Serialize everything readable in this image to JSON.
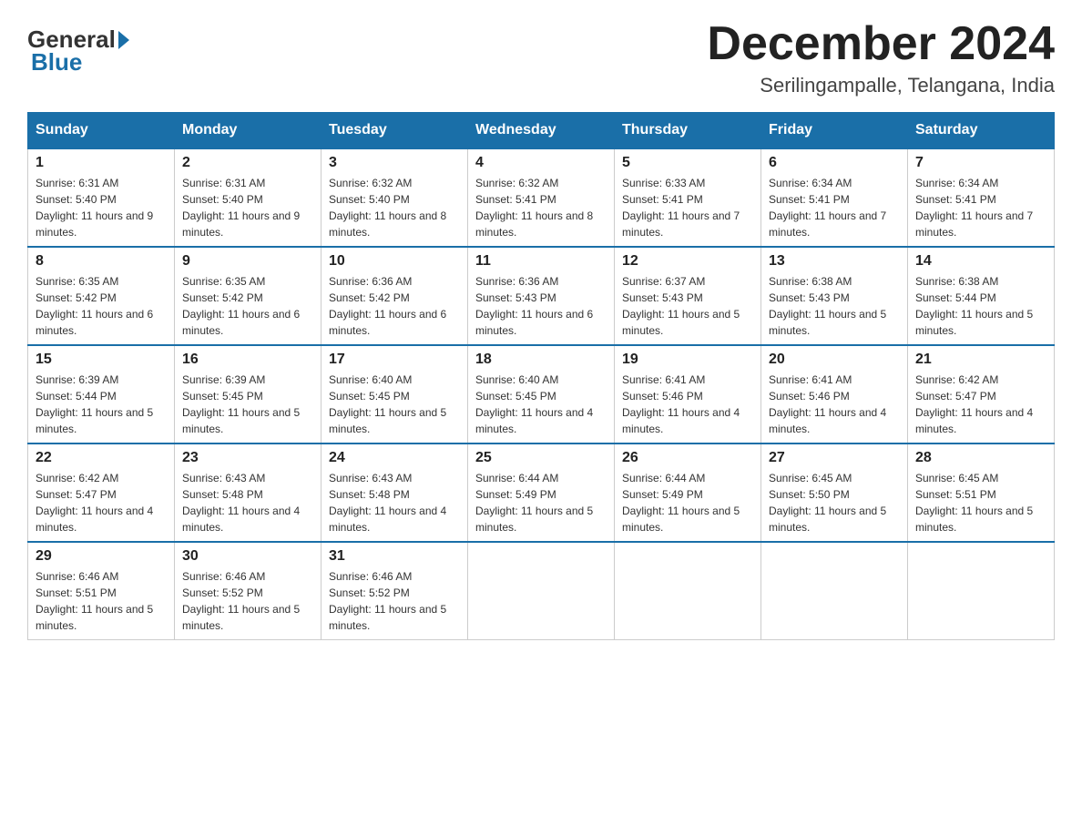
{
  "logo": {
    "general": "General",
    "blue": "Blue"
  },
  "header": {
    "month_year": "December 2024",
    "location": "Serilingampalle, Telangana, India"
  },
  "weekdays": [
    "Sunday",
    "Monday",
    "Tuesday",
    "Wednesday",
    "Thursday",
    "Friday",
    "Saturday"
  ],
  "weeks": [
    [
      {
        "day": "1",
        "sunrise": "6:31 AM",
        "sunset": "5:40 PM",
        "daylight": "11 hours and 9 minutes."
      },
      {
        "day": "2",
        "sunrise": "6:31 AM",
        "sunset": "5:40 PM",
        "daylight": "11 hours and 9 minutes."
      },
      {
        "day": "3",
        "sunrise": "6:32 AM",
        "sunset": "5:40 PM",
        "daylight": "11 hours and 8 minutes."
      },
      {
        "day": "4",
        "sunrise": "6:32 AM",
        "sunset": "5:41 PM",
        "daylight": "11 hours and 8 minutes."
      },
      {
        "day": "5",
        "sunrise": "6:33 AM",
        "sunset": "5:41 PM",
        "daylight": "11 hours and 7 minutes."
      },
      {
        "day": "6",
        "sunrise": "6:34 AM",
        "sunset": "5:41 PM",
        "daylight": "11 hours and 7 minutes."
      },
      {
        "day": "7",
        "sunrise": "6:34 AM",
        "sunset": "5:41 PM",
        "daylight": "11 hours and 7 minutes."
      }
    ],
    [
      {
        "day": "8",
        "sunrise": "6:35 AM",
        "sunset": "5:42 PM",
        "daylight": "11 hours and 6 minutes."
      },
      {
        "day": "9",
        "sunrise": "6:35 AM",
        "sunset": "5:42 PM",
        "daylight": "11 hours and 6 minutes."
      },
      {
        "day": "10",
        "sunrise": "6:36 AM",
        "sunset": "5:42 PM",
        "daylight": "11 hours and 6 minutes."
      },
      {
        "day": "11",
        "sunrise": "6:36 AM",
        "sunset": "5:43 PM",
        "daylight": "11 hours and 6 minutes."
      },
      {
        "day": "12",
        "sunrise": "6:37 AM",
        "sunset": "5:43 PM",
        "daylight": "11 hours and 5 minutes."
      },
      {
        "day": "13",
        "sunrise": "6:38 AM",
        "sunset": "5:43 PM",
        "daylight": "11 hours and 5 minutes."
      },
      {
        "day": "14",
        "sunrise": "6:38 AM",
        "sunset": "5:44 PM",
        "daylight": "11 hours and 5 minutes."
      }
    ],
    [
      {
        "day": "15",
        "sunrise": "6:39 AM",
        "sunset": "5:44 PM",
        "daylight": "11 hours and 5 minutes."
      },
      {
        "day": "16",
        "sunrise": "6:39 AM",
        "sunset": "5:45 PM",
        "daylight": "11 hours and 5 minutes."
      },
      {
        "day": "17",
        "sunrise": "6:40 AM",
        "sunset": "5:45 PM",
        "daylight": "11 hours and 5 minutes."
      },
      {
        "day": "18",
        "sunrise": "6:40 AM",
        "sunset": "5:45 PM",
        "daylight": "11 hours and 4 minutes."
      },
      {
        "day": "19",
        "sunrise": "6:41 AM",
        "sunset": "5:46 PM",
        "daylight": "11 hours and 4 minutes."
      },
      {
        "day": "20",
        "sunrise": "6:41 AM",
        "sunset": "5:46 PM",
        "daylight": "11 hours and 4 minutes."
      },
      {
        "day": "21",
        "sunrise": "6:42 AM",
        "sunset": "5:47 PM",
        "daylight": "11 hours and 4 minutes."
      }
    ],
    [
      {
        "day": "22",
        "sunrise": "6:42 AM",
        "sunset": "5:47 PM",
        "daylight": "11 hours and 4 minutes."
      },
      {
        "day": "23",
        "sunrise": "6:43 AM",
        "sunset": "5:48 PM",
        "daylight": "11 hours and 4 minutes."
      },
      {
        "day": "24",
        "sunrise": "6:43 AM",
        "sunset": "5:48 PM",
        "daylight": "11 hours and 4 minutes."
      },
      {
        "day": "25",
        "sunrise": "6:44 AM",
        "sunset": "5:49 PM",
        "daylight": "11 hours and 5 minutes."
      },
      {
        "day": "26",
        "sunrise": "6:44 AM",
        "sunset": "5:49 PM",
        "daylight": "11 hours and 5 minutes."
      },
      {
        "day": "27",
        "sunrise": "6:45 AM",
        "sunset": "5:50 PM",
        "daylight": "11 hours and 5 minutes."
      },
      {
        "day": "28",
        "sunrise": "6:45 AM",
        "sunset": "5:51 PM",
        "daylight": "11 hours and 5 minutes."
      }
    ],
    [
      {
        "day": "29",
        "sunrise": "6:46 AM",
        "sunset": "5:51 PM",
        "daylight": "11 hours and 5 minutes."
      },
      {
        "day": "30",
        "sunrise": "6:46 AM",
        "sunset": "5:52 PM",
        "daylight": "11 hours and 5 minutes."
      },
      {
        "day": "31",
        "sunrise": "6:46 AM",
        "sunset": "5:52 PM",
        "daylight": "11 hours and 5 minutes."
      },
      null,
      null,
      null,
      null
    ]
  ]
}
